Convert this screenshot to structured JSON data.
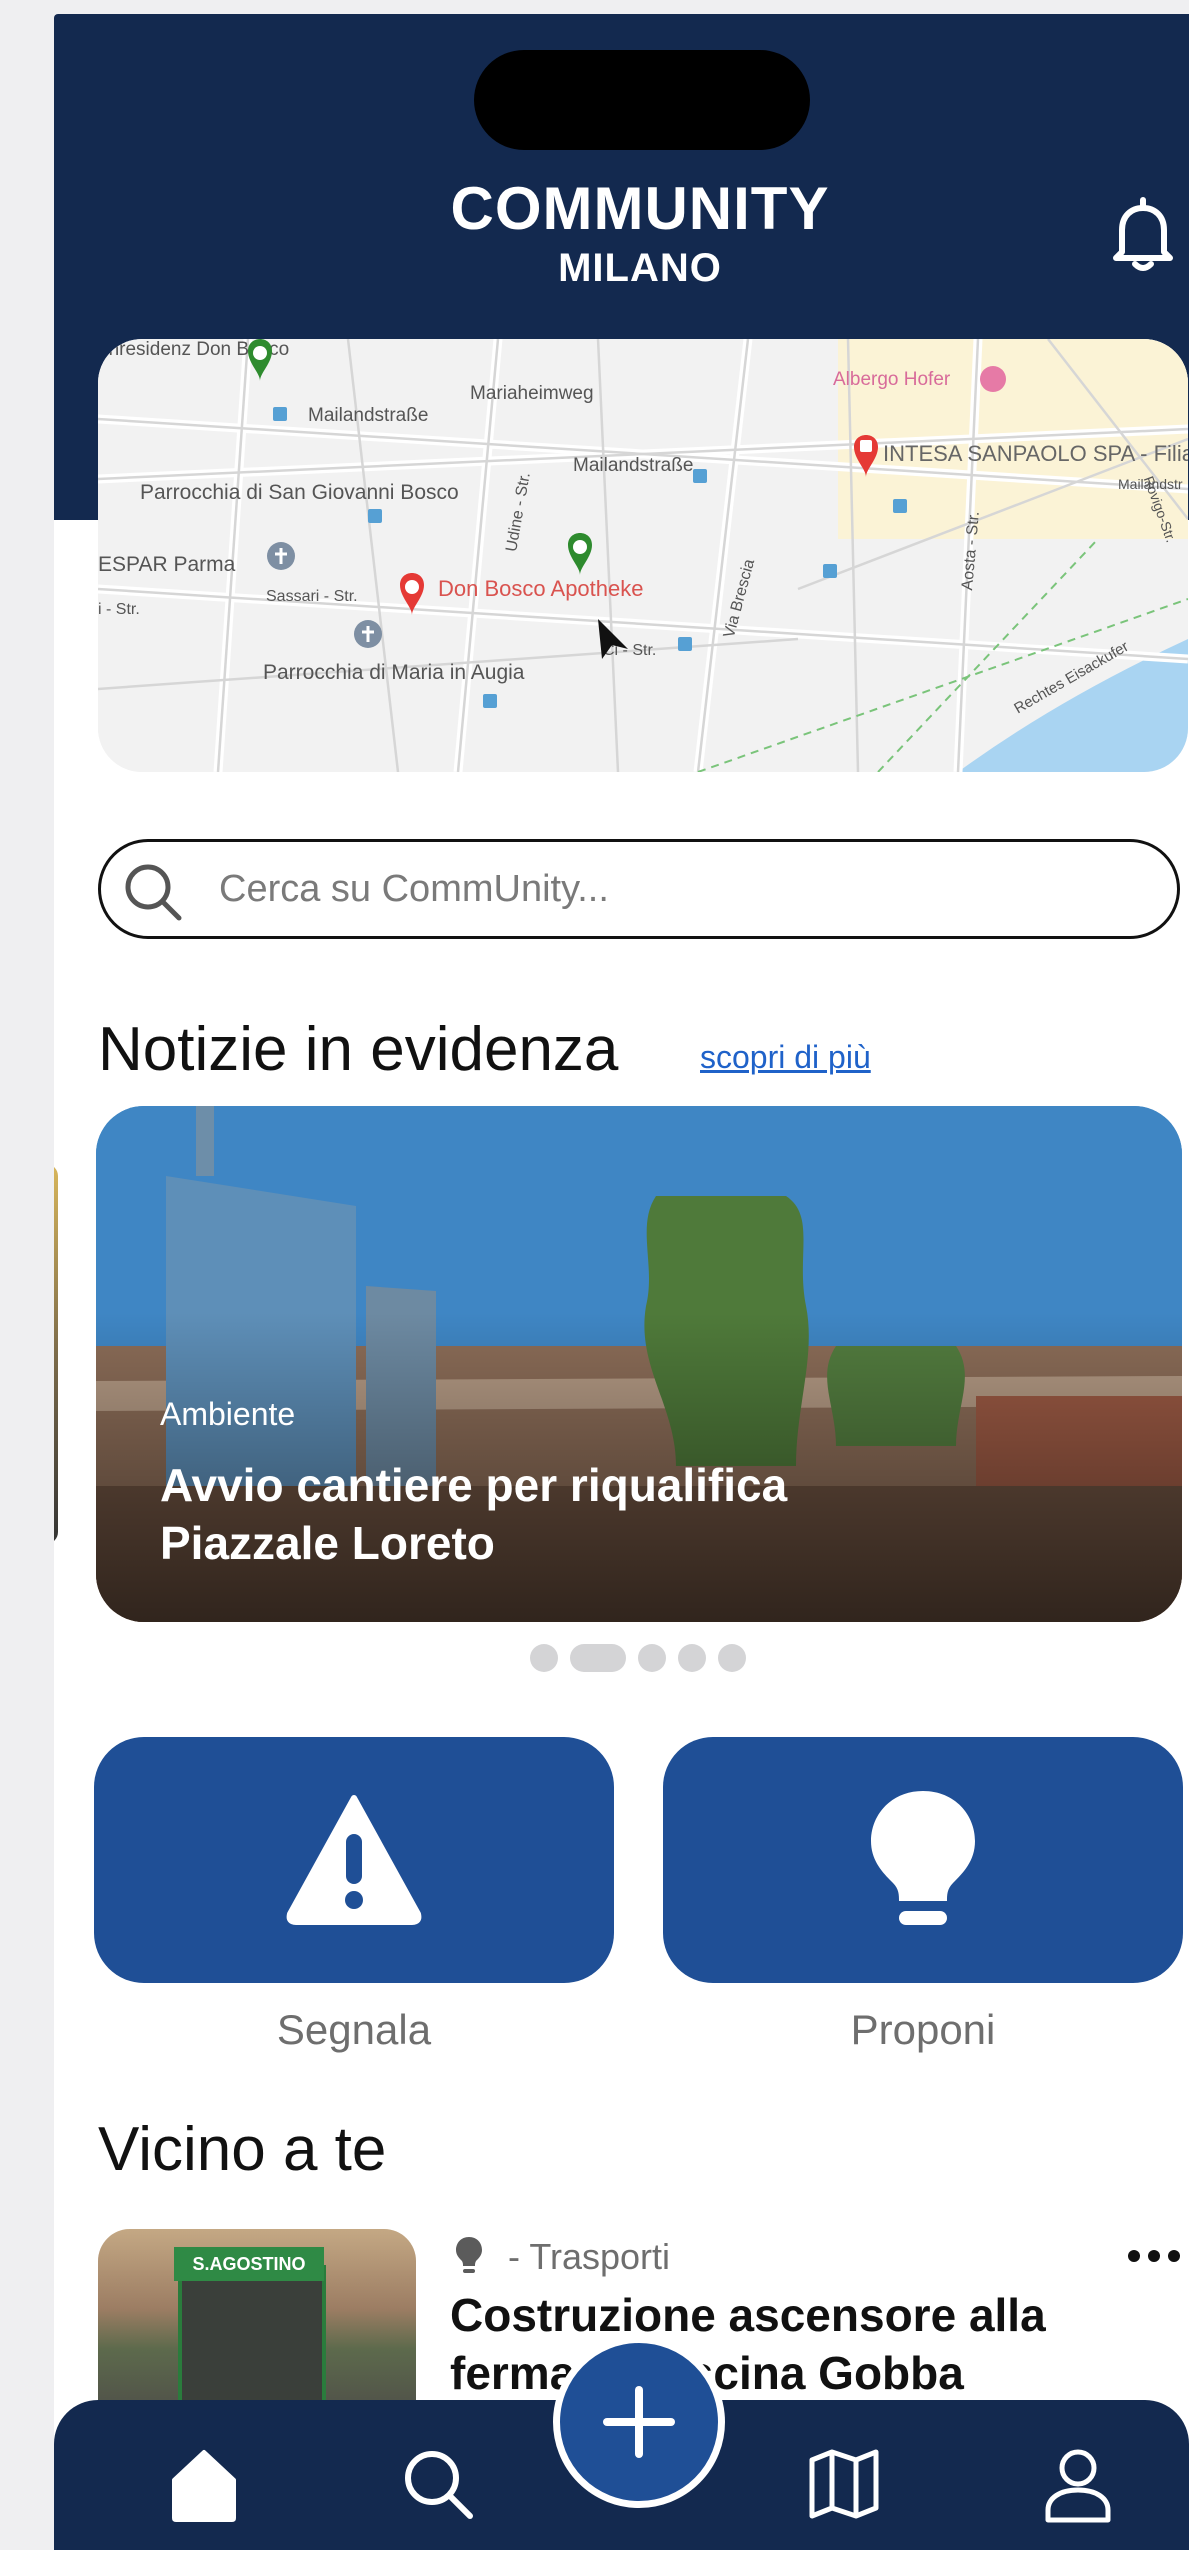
{
  "header": {
    "title": "COMMUNITY",
    "subtitle": "MILANO"
  },
  "icons": {
    "bell": "bell-icon",
    "search": "search-icon",
    "warning": "warning-icon",
    "lightbulb": "lightbulb-icon",
    "home": "home-icon",
    "map": "map-icon",
    "user": "user-icon",
    "plus": "plus-icon",
    "more": "more-icon"
  },
  "map": {
    "labels": [
      "enresidenz Don Bosco",
      "Mariaheimweg",
      "Albergo Hofer",
      "Mailandstraße",
      "Mailandstraße",
      "INTESA SANPAOLO SPA - Filiale HUB",
      "Parrocchia di San Giovanni Bosco",
      "ESPAR Parma",
      "Don Bosco Apotheke",
      "Sassari - Str.",
      "Udine - Str.",
      "Via Brescia",
      "Aosta - Str.",
      "Parrocchia di Maria in Augia",
      "Rechtes Eisackufer",
      "Rovigo-Str.",
      "Ci - Str.",
      "Mailandstr",
      "i - Str."
    ]
  },
  "search": {
    "placeholder": "Cerca su CommUnity..."
  },
  "news": {
    "section_title": "Notizie in evidenza",
    "link": "scopri di più",
    "card": {
      "category": "Ambiente",
      "title": "Avvio cantiere per riqualifica Piazzale Loreto"
    },
    "dots_total": 5,
    "active_dot": 2
  },
  "actions": [
    {
      "label": "Segnala",
      "icon": "warning-icon"
    },
    {
      "label": "Proponi",
      "icon": "lightbulb-icon"
    }
  ],
  "nearby": {
    "section_title": "Vicino a te",
    "item": {
      "category": "- Trasporti",
      "title": "Costruzione ascensore alla fermata Cascina Gobba",
      "image_sign": "S.AGOSTINO"
    }
  },
  "colors": {
    "navy": "#13294f",
    "button_blue": "#1f4f96",
    "link_blue": "#1f62c9",
    "pin_red": "#e53935",
    "pin_green": "#2e8b2e"
  }
}
